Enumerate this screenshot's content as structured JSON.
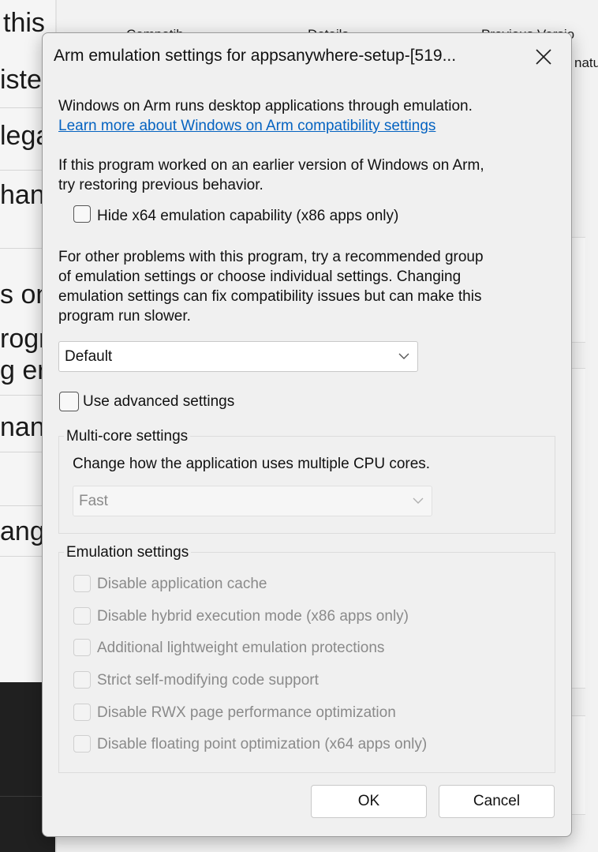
{
  "background": {
    "left_fragments": [
      "this",
      "iste",
      "lega",
      "han",
      "s on",
      "rogr",
      "g er",
      "nang",
      "ange"
    ],
    "header_cells": [
      "Compatib",
      "Details",
      "Previous Versio",
      "natu"
    ]
  },
  "dialog": {
    "title": "Arm emulation settings for appsanywhere-setup-[519...",
    "intro_line": "Windows on Arm runs desktop applications through emulation.",
    "learn_more_link": "Learn more about Windows on Arm compatibility settings",
    "restore_line1": "If this program worked on an earlier version of Windows on Arm,",
    "restore_line2": "try restoring previous behavior.",
    "hide_x64_label": "Hide x64 emulation capability (x86 apps only)",
    "other_line1": "For other problems with this program, try a recommended group",
    "other_line2": "of emulation settings or choose individual settings.  Changing",
    "other_line3": "emulation settings can fix compatibility issues but can make this",
    "other_line4": "program run slower.",
    "preset_select": {
      "value": "Default"
    },
    "advanced_label": "Use advanced settings",
    "multicore": {
      "legend": "Multi-core settings",
      "description": "Change how the application uses multiple CPU cores.",
      "select_value": "Fast"
    },
    "emulation": {
      "legend": "Emulation settings",
      "options": [
        "Disable application cache",
        "Disable hybrid execution mode (x86 apps only)",
        "Additional lightweight emulation protections",
        "Strict self-modifying code support",
        "Disable RWX page performance optimization",
        "Disable floating point optimization (x64 apps only)"
      ]
    },
    "ok_label": "OK",
    "cancel_label": "Cancel"
  },
  "icons": {
    "close": "close-icon",
    "chevron": "chevron-down-icon"
  },
  "colors": {
    "link": "#0563c1",
    "disabled_text": "#8a8a8a",
    "dialog_bg": "#f0f0f0"
  }
}
